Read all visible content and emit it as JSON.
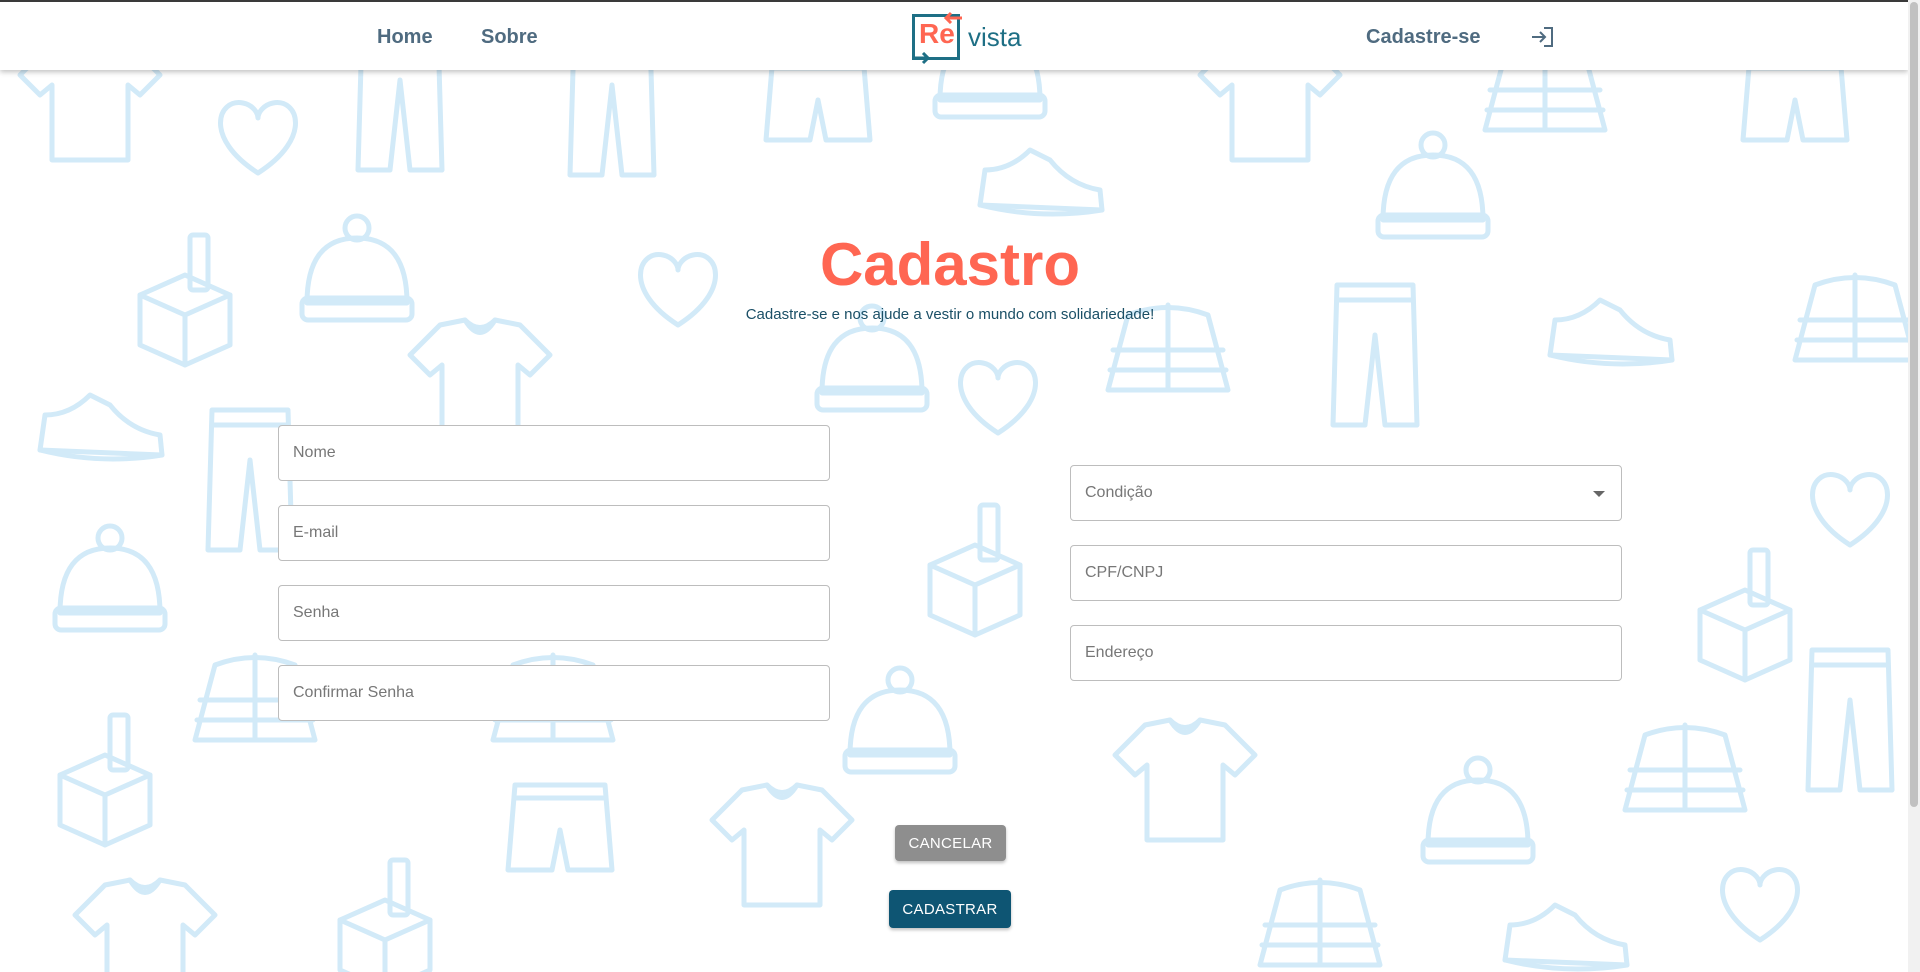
{
  "header": {
    "nav": [
      {
        "label": "Home"
      },
      {
        "label": "Sobre"
      }
    ],
    "logo": {
      "part1": "Re",
      "part2": "vista"
    },
    "register_link": "Cadastre-se",
    "login_icon": "login-icon"
  },
  "main": {
    "title": "Cadastro",
    "subtitle": "Cadastre-se e nos ajude a vestir o mundo com solidariedade!",
    "left_fields": [
      {
        "placeholder": "Nome",
        "value": ""
      },
      {
        "placeholder": "E-mail",
        "value": ""
      },
      {
        "placeholder": "Senha",
        "value": ""
      },
      {
        "placeholder": "Confirmar Senha",
        "value": ""
      }
    ],
    "right_fields": {
      "condition_select": {
        "label": "Condição",
        "icon": "chevron-down-icon"
      },
      "cpf": {
        "placeholder": "CPF/CNPJ",
        "value": ""
      },
      "address": {
        "placeholder": "Endereço",
        "value": ""
      }
    },
    "cancel_label": "CANCELAR",
    "submit_label": "CADASTRAR"
  },
  "colors": {
    "accent": "#ff6652",
    "brand": "#1e6f85",
    "nav_text": "#4f6b80",
    "submit_button": "#0e5573",
    "cancel_button": "#8e8e8e",
    "pattern": "#d2eaf8"
  },
  "background": {
    "motifs": [
      "shirt-icon",
      "pants-icon",
      "shorts-icon",
      "beanie-icon",
      "heart-icon",
      "sneaker-icon",
      "jacket-icon",
      "donation-box-icon"
    ]
  }
}
